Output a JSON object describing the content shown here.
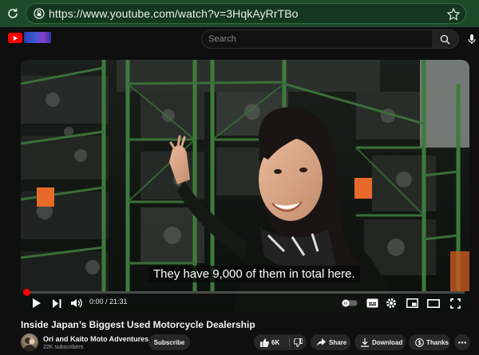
{
  "browser": {
    "url": "https://www.youtube.com/watch?v=3HqkAyRrTBo"
  },
  "header": {
    "search_placeholder": "Search"
  },
  "player": {
    "caption": "They have 9,000 of them in total here.",
    "time_current": "0:00",
    "time_separator": " / ",
    "time_total": "21:31",
    "time_display": "0:00 / 21:31",
    "progress_fraction": 0.0
  },
  "video": {
    "title": "Inside Japan’s Biggest Used Motorcycle Dealership",
    "channel": "Ori and Kaito Moto Adventures",
    "subscribers": "22K subscribers",
    "subscribe_label": "Subscribe",
    "likes": "6K",
    "share_label": "Share",
    "download_label": "Download",
    "thanks_label": "Thanks"
  },
  "colors": {
    "browser_bar": "#1f4a2a",
    "yt_red": "#ff0000",
    "background": "#0f0f0f",
    "pill": "#272727"
  },
  "icons": [
    "reload-icon",
    "lock-icon",
    "star-icon",
    "youtube-logo-icon",
    "search-icon",
    "mic-icon",
    "play-icon",
    "next-icon",
    "volume-icon",
    "autoplay-toggle-icon",
    "subtitles-icon",
    "settings-icon",
    "miniplayer-icon",
    "theater-icon",
    "fullscreen-icon",
    "like-icon",
    "dislike-icon",
    "share-icon",
    "download-icon",
    "thanks-icon",
    "more-icon"
  ]
}
